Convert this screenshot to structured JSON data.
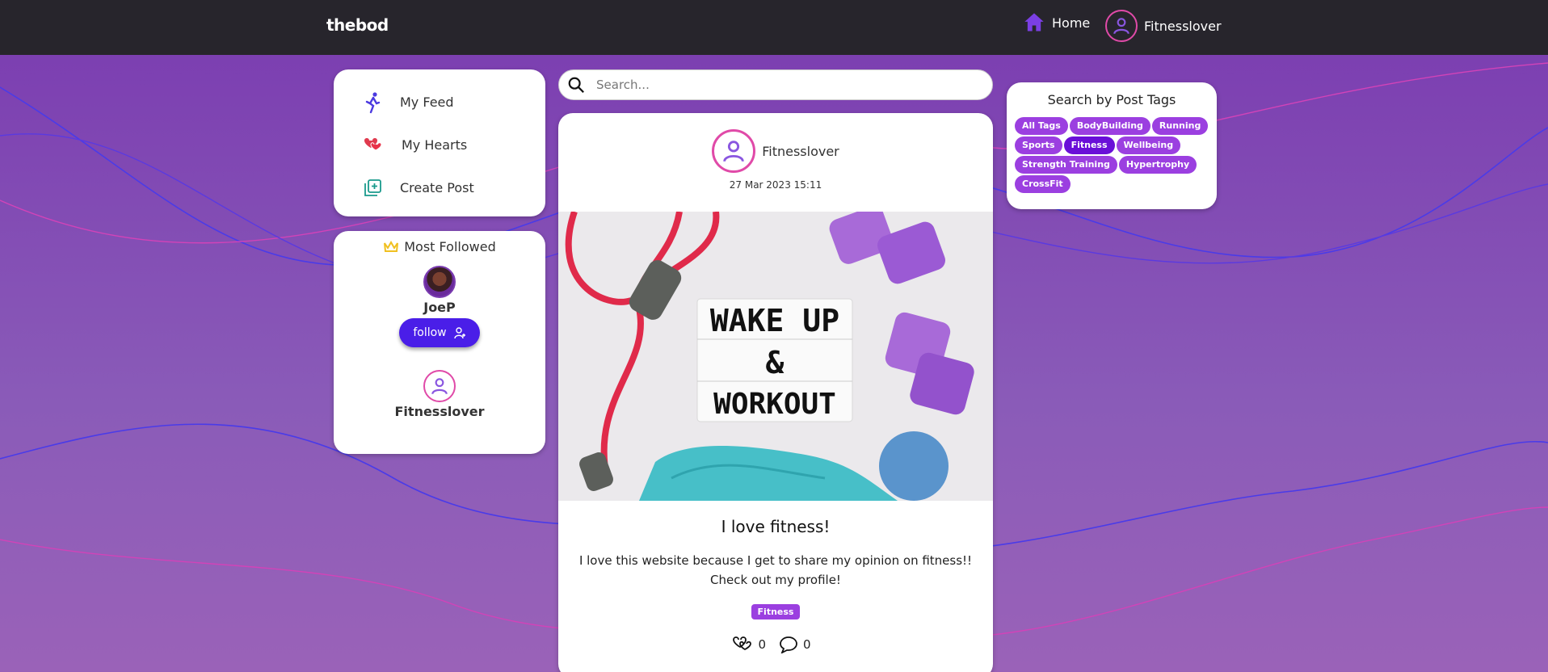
{
  "colors": {
    "topbar": "#27252c",
    "accent": "#9b3fe0",
    "active_tag": "#6a0fd8",
    "follow_button": "#4a1ee8",
    "avatar_ring": "#e04aa8"
  },
  "header": {
    "brand": "thebod",
    "home_label": "Home",
    "home_icon": "house-icon",
    "user_name": "Fitnesslover"
  },
  "sidebar": {
    "items": [
      {
        "label": "My Feed",
        "icon": "running-figure-icon"
      },
      {
        "label": "My Hearts",
        "icon": "hearts-icon"
      },
      {
        "label": "Create Post",
        "icon": "add-post-icon"
      }
    ]
  },
  "most_followed": {
    "title": "Most Followed",
    "users": [
      {
        "name": "JoeP",
        "button": "follow"
      },
      {
        "name": "Fitnesslover"
      }
    ]
  },
  "search": {
    "placeholder": "Search..."
  },
  "post": {
    "author": "Fitnesslover",
    "date": "27 Mar 2023 15:11",
    "image_text": [
      "WAKE UP",
      "&",
      "WORKOUT"
    ],
    "title": "I love fitness!",
    "body": "I love this website because I get to share my opinion on fitness!! Check out my profile!",
    "tag": "Fitness",
    "hearts": "0",
    "comments": "0"
  },
  "tag_panel": {
    "title": "Search by Post Tags",
    "tags": [
      "All Tags",
      "BodyBuilding",
      "Running",
      "Sports",
      "Fitness",
      "Wellbeing",
      "Strength Training",
      "Hypertrophy",
      "CrossFit"
    ],
    "active": "Fitness"
  }
}
